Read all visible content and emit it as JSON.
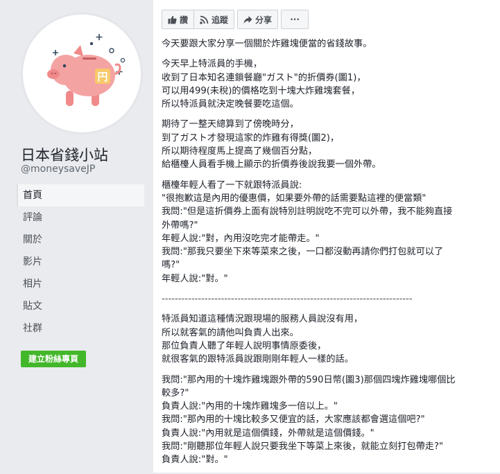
{
  "sidebar": {
    "page_name": "日本省錢小站",
    "page_handle": "@moneysaveJP",
    "avatar_badge": "円",
    "nav_items": [
      {
        "label": "首頁"
      },
      {
        "label": "評論"
      },
      {
        "label": "關於"
      },
      {
        "label": "影片"
      },
      {
        "label": "相片"
      },
      {
        "label": "貼文"
      },
      {
        "label": "社群"
      }
    ],
    "create_button": "建立粉絲專頁"
  },
  "toolbar": {
    "like_label": "讚",
    "follow_label": "追蹤",
    "share_label": "分享",
    "more_label": "···"
  },
  "post": {
    "p1": [
      "今天要跟大家分享一個關於炸雞塊便當的省錢故事。"
    ],
    "p2": [
      "今天早上特派員的手機，",
      "收到了日本知名連鎖餐廳\"ガスト\"的折價券(圖1)，",
      "可以用499(未稅)的價格吃到十塊大炸雞塊套餐，",
      "所以特派員就決定晚餐要吃這個。"
    ],
    "p3": [
      "期待了一整天總算到了傍晚時分，",
      "到了ガスト才發現這家的炸雞有得獎(圖2)，",
      "所以期待程度馬上提高了幾個百分點，",
      "給櫃檯人員看手機上顯示的折價券後說我要一個外帶。"
    ],
    "p4": [
      "櫃檯年輕人看了一下就跟特派員說:",
      "\"很抱歉這是內用的優惠價，如果要外帶的話需要點這裡的便當類\"",
      "我問:\"但是這折價券上面有說特別註明說吃不完可以外帶，我不能夠直接",
      "外帶嗎?\"",
      "年輕人說:\"對，內用沒吃完才能帶走。\"",
      "我問:\"那我只要坐下來等菜來之後，一口都沒動再請你們打包就可以了",
      "嗎?\"",
      "年輕人說:\"對。\""
    ],
    "separator": "----------------------------------------------------------------------------",
    "p5": [
      "特派員知道這種情況跟現場的服務人員說沒有用，",
      "所以就客氣的請他叫負責人出來。",
      "那位負責人聽了年輕人說明事情原委後，",
      "就很客氣的跟特派員說跟剛剛年輕人一樣的話。"
    ],
    "p6": [
      "我問:\"那內用的十塊炸雞塊跟外帶的590日幣(圖3)那個四塊炸雞塊哪個比",
      "較多?\"",
      "負責人說:\"內用的十塊炸雞塊多一倍以上。\"",
      "我問:\"那內用的十塊比較多又便宜的話，大家應該都會選這個吧?\"",
      "負責人說:\"內用就是這個價錢，外帶就是這個價錢。\"",
      "我問:\"剛聽那位年輕人說只要我坐下等菜上來後，就能立刻打包帶走?\"",
      "負責人說:\"對。\""
    ]
  }
}
